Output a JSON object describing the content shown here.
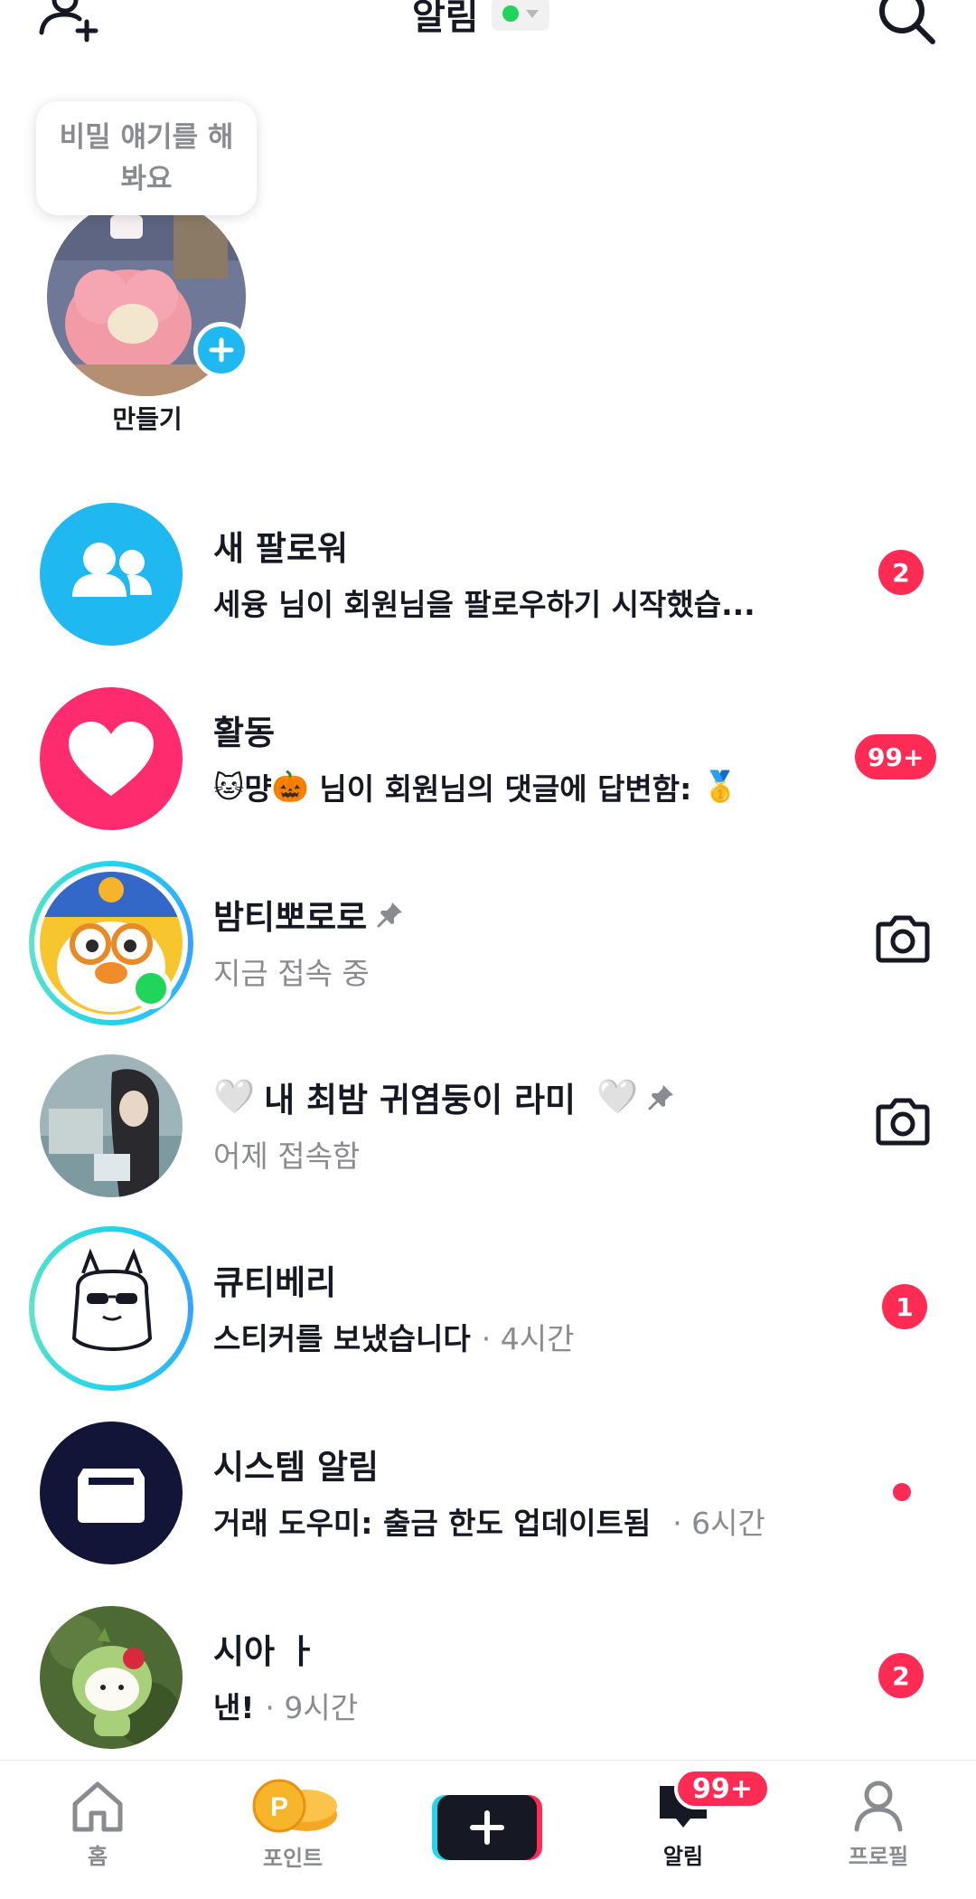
{
  "header": {
    "title": "알림",
    "status_color": "#20d55a",
    "add_friend_icon": "add-friend-icon",
    "search_icon": "search-icon"
  },
  "story": {
    "bubble": "비밀 얘기를 해\n봐요",
    "label": "만들기"
  },
  "rows": [
    {
      "id": "new-followers",
      "name": "새 팔로워",
      "sub": "세융 님이 회원님을 팔로우하기 시작했습...",
      "badge": "2",
      "icon": "people-icon",
      "bg": "#20b8f0"
    },
    {
      "id": "activity",
      "name": "활동",
      "sub_emoji1": "🐱",
      "sub_text1": "먕",
      "sub_emoji2": "🎃",
      "sub_text2": " 님이 회원님의 댓글에 답변함: ",
      "sub_emoji3": "🥇",
      "badge": "99+",
      "icon": "heart-icon",
      "bg": "#fe2c6f"
    },
    {
      "id": "bamti-pororo",
      "name": "밤티뽀로로",
      "sub": "지금 접속 중",
      "icon": "camera-icon"
    },
    {
      "id": "lami",
      "name_emoji": "🤍",
      "name": "내 최밤 귀염둥이 라미 ",
      "name_emoji2": "🤍",
      "sub": "어제 접속함",
      "icon": "camera-icon"
    },
    {
      "id": "cutieberry",
      "name": "큐티베리",
      "sub": "스티커를 보냈습니다",
      "time": "· 4시간",
      "badge": "1"
    },
    {
      "id": "system",
      "name": "시스템 알림",
      "sub": "거래 도우미: 출금 한도 업데이트됨",
      "time": "· 6시간",
      "icon": "inbox-icon",
      "bg": "#121538"
    },
    {
      "id": "sia",
      "name": "시아 ㅏ",
      "sub": "낸!",
      "time": "· 9시간",
      "badge": "2"
    }
  ],
  "nav": {
    "home": "홈",
    "points": "포인트",
    "inbox": "알림",
    "inbox_badge": "99+",
    "profile": "프로필"
  },
  "colors": {
    "accent": "#fe2c55",
    "blue": "#20b8f0",
    "pink": "#fe2c6f",
    "navy": "#121538"
  }
}
